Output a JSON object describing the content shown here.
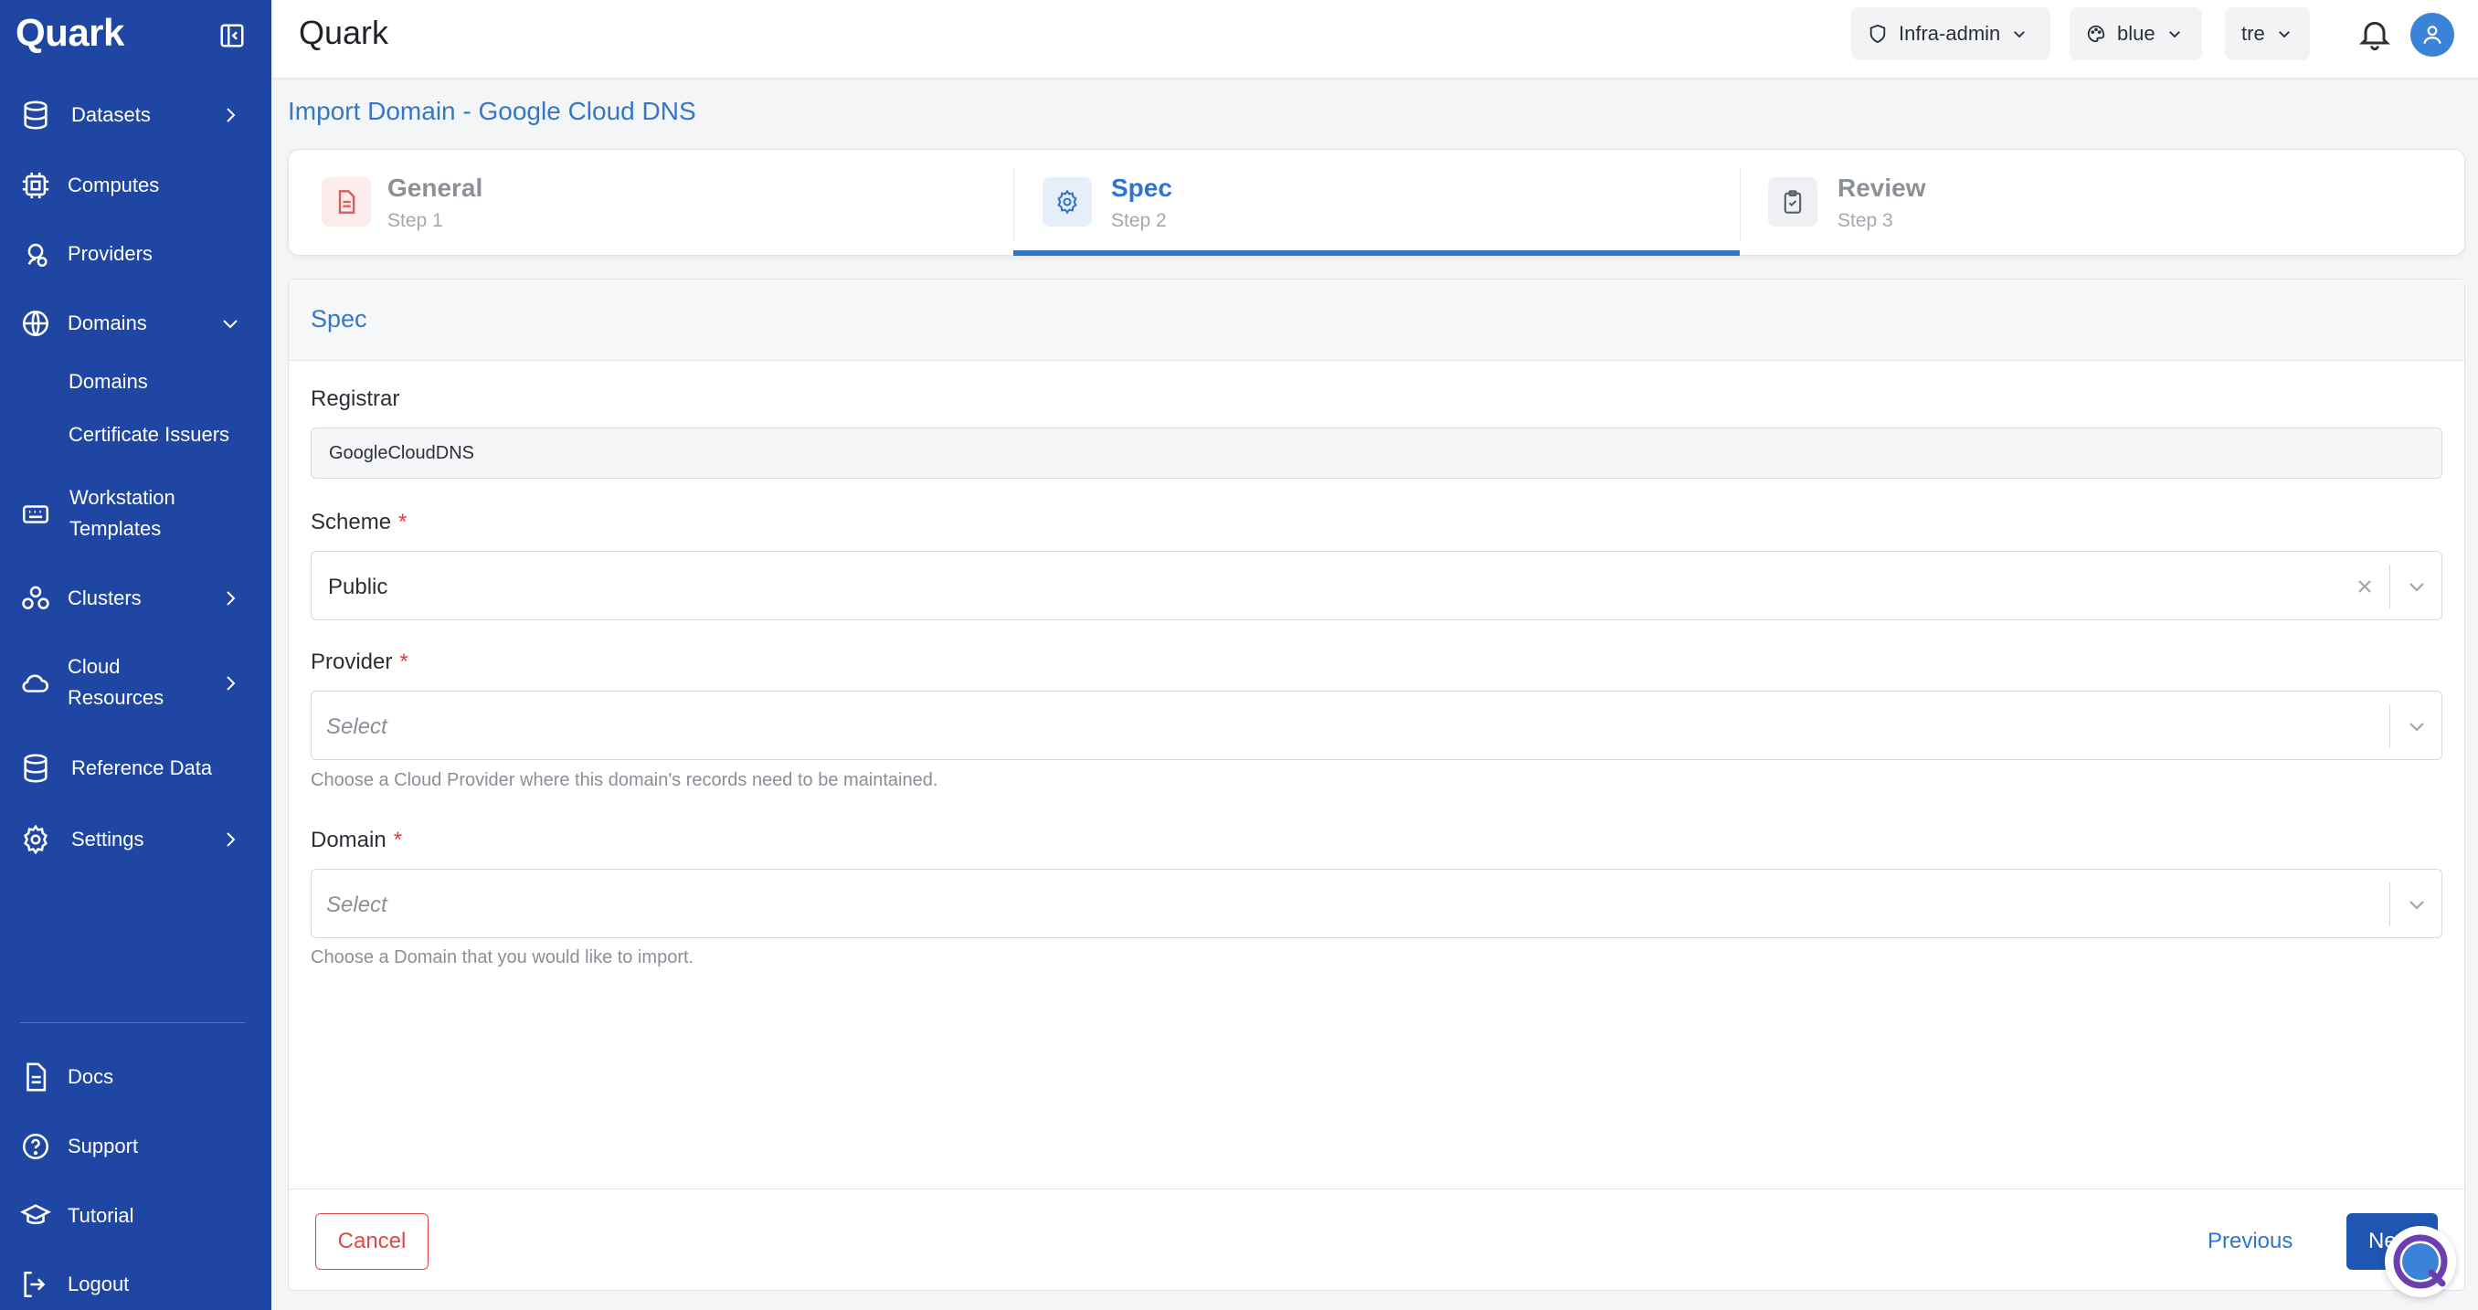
{
  "sidebar": {
    "brand": "Quark",
    "items": [
      {
        "label": "Datasets",
        "icon": "database-icon"
      },
      {
        "label": "Computes",
        "icon": "chip-icon"
      },
      {
        "label": "Providers",
        "icon": "providers-icon"
      },
      {
        "label": "Domains",
        "icon": "globe-icon"
      },
      {
        "label": "Workstation Templates",
        "icon": "keyboard-icon"
      },
      {
        "label": "Clusters",
        "icon": "clusters-icon"
      },
      {
        "label": "Cloud Resources",
        "icon": "cloud-icon"
      },
      {
        "label": "Reference Data",
        "icon": "database-icon"
      },
      {
        "label": "Settings",
        "icon": "gear-icon"
      }
    ],
    "domain_subitems": [
      "Domains",
      "Certificate Issuers"
    ],
    "workstation_line1": "Workstation",
    "workstation_line2": "Templates",
    "cloud_line1": "Cloud",
    "cloud_line2": "Resources",
    "bottom": [
      {
        "label": "Docs",
        "icon": "doc-icon"
      },
      {
        "label": "Support",
        "icon": "help-icon"
      },
      {
        "label": "Tutorial",
        "icon": "graduation-icon"
      },
      {
        "label": "Logout",
        "icon": "logout-icon"
      }
    ]
  },
  "topbar": {
    "title": "Quark",
    "role": "Infra-admin",
    "theme": "blue",
    "tenant": "tre"
  },
  "page": {
    "title": "Import Domain - Google Cloud DNS"
  },
  "stepper": {
    "steps": [
      {
        "title": "General",
        "sub": "Step 1"
      },
      {
        "title": "Spec",
        "sub": "Step 2"
      },
      {
        "title": "Review",
        "sub": "Step 3"
      }
    ],
    "active_index": 1
  },
  "form": {
    "section_title": "Spec",
    "registrar_label": "Registrar",
    "registrar_value": "GoogleCloudDNS",
    "scheme_label": "Scheme",
    "scheme_value": "Public",
    "provider_label": "Provider",
    "provider_placeholder": "Select",
    "provider_help": "Choose a Cloud Provider where this domain's records need to be maintained.",
    "domain_label": "Domain",
    "domain_placeholder": "Select",
    "domain_help": "Choose a Domain that you would like to import.",
    "required_mark": "*"
  },
  "footer": {
    "cancel": "Cancel",
    "previous": "Previous",
    "next": "Next"
  },
  "colors": {
    "sidebar_bg": "#1f46a3",
    "accent": "#2f74d0",
    "danger": "#e04848"
  }
}
